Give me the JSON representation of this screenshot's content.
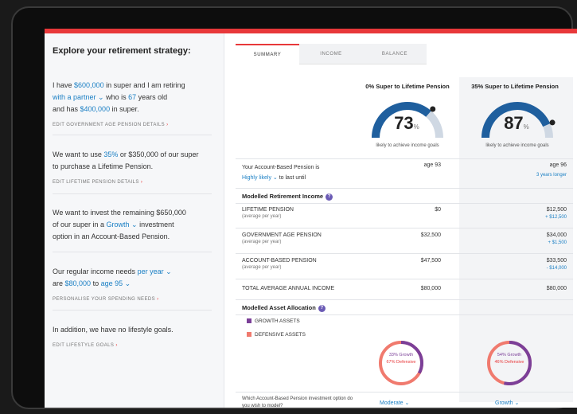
{
  "left": {
    "title": "Explore your retirement strategy:",
    "b1": {
      "t1": "I have ",
      "super": "$600,000",
      "t2": " in super and I am retiring",
      "partner": "with a partner ⌄",
      "t3": " who is ",
      "age": "67",
      "t4": " years old",
      "t5": "and has ",
      "assets": "$400,000",
      "t6": " in super.",
      "edit": "EDIT GOVERNMENT AGE PENSION DETAILS"
    },
    "b2": {
      "t1": "We want to use ",
      "pct": "35%",
      "t2": " or $350,000 of our super",
      "t3": "to purchase a Lifetime Pension.",
      "edit": "EDIT LIFETIME PENSION DETAILS"
    },
    "b3": {
      "t1": "We want to invest the remaining $650,000",
      "t2": "of our super in a ",
      "option": "Growth ⌄",
      "t3": " investment",
      "t4": "option in an Account-Based Pension.",
      "edit": ""
    },
    "b4": {
      "t1": "Our regular income needs ",
      "freq": "per year ⌄",
      "t2": "are ",
      "amount": "$80,000",
      "t3": " to ",
      "age": "age 95 ⌄",
      "edit": "PERSONALISE YOUR SPENDING NEEDS"
    },
    "b5": {
      "t1": "In addition, we have no lifestyle goals.",
      "edit": "EDIT LIFESTYLE GOALS"
    }
  },
  "tabs": [
    "SUMMARY",
    "INCOME",
    "BALANCE"
  ],
  "columns": [
    "0% Super to Lifetime Pension",
    "35% Super to Lifetime Pension"
  ],
  "gauges": [
    {
      "value": 73,
      "pct": "%",
      "caption": "likely to achieve income goals"
    },
    {
      "value": 87,
      "pct": "%",
      "caption": "likely to achieve income goals"
    }
  ],
  "abp": {
    "label": "Your Account-Based Pension is",
    "likely": "Highly likely ⌄",
    "tail": " to last until",
    "v1": "age 93",
    "v2": "age 96",
    "v2sub": "3 years longer"
  },
  "income": {
    "title": "Modelled Retirement Income",
    "rows": [
      {
        "label": "LIFETIME PENSION",
        "sub": "(average per year)",
        "v1": "$0",
        "v2": "$12,500",
        "d2": "+ $12,500"
      },
      {
        "label": "GOVERNMENT AGE PENSION",
        "sub": "(average per year)",
        "v1": "$32,500",
        "v2": "$34,000",
        "d2": "+ $1,500"
      },
      {
        "label": "ACCOUNT-BASED PENSION",
        "sub": "(average per year)",
        "v1": "$47,500",
        "v2": "$33,500",
        "d2": "- $14,000"
      }
    ],
    "total": {
      "label": "TOTAL AVERAGE ANNUAL INCOME",
      "v1": "$80,000",
      "v2": "$80,000"
    }
  },
  "allocation": {
    "title": "Modelled Asset Allocation",
    "legend": [
      "GROWTH ASSETS",
      "DEFENSIVE ASSETS"
    ],
    "colors": {
      "growth": "#7b3f98",
      "defensive": "#e8383a"
    },
    "d1": {
      "growth": "33% Growth",
      "defensive": "67% Defensive",
      "g": 33
    },
    "d2": {
      "growth": "54% Growth",
      "defensive": "46% Defensive",
      "g": 54
    }
  },
  "question": {
    "text": "Which Account-Based Pension investment option do you wish to model?",
    "s1": "Moderate ⌄",
    "s2": "Growth ⌄"
  }
}
